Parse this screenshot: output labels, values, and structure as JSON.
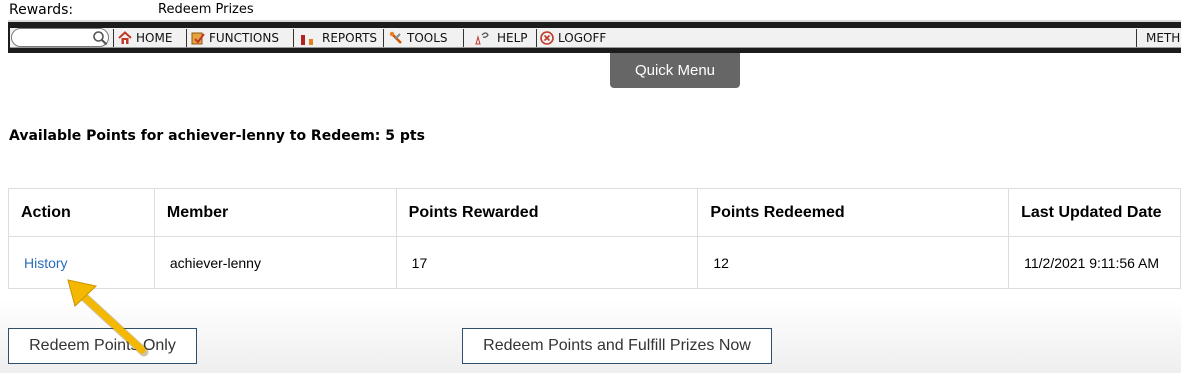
{
  "header": {
    "section_label": "Rewards:",
    "page_label": "Redeem Prizes"
  },
  "nav": {
    "items": [
      {
        "label": "HOME",
        "icon": "home-icon"
      },
      {
        "label": "FUNCTIONS",
        "icon": "functions-icon"
      },
      {
        "label": "REPORTS",
        "icon": "reports-icon"
      },
      {
        "label": "TOOLS",
        "icon": "tools-icon"
      },
      {
        "label": "HELP",
        "icon": "help-icon"
      },
      {
        "label": "LOGOFF",
        "icon": "logoff-icon"
      },
      {
        "label": "METH"
      }
    ]
  },
  "quick_menu": "Quick Menu",
  "points_message": "Available Points for achiever-lenny to Redeem: 5 pts",
  "table": {
    "headers": [
      "Action",
      "Member",
      "Points Rewarded",
      "Points Redeemed",
      "Last Updated Date"
    ],
    "rows": [
      {
        "action": "History",
        "member": "achiever-lenny",
        "rewarded": "17",
        "redeemed": "12",
        "updated": "11/2/2021 9:11:56 AM"
      }
    ]
  },
  "buttons": {
    "redeem_only": "Redeem Points Only",
    "redeem_fulfill": "Redeem Points and Fulfill Prizes Now"
  },
  "colors": {
    "link": "#2a6ebb",
    "quick_menu_bg": "#666666",
    "annotation_arrow": "#f5b800",
    "navbar": "#1c1c1c"
  }
}
